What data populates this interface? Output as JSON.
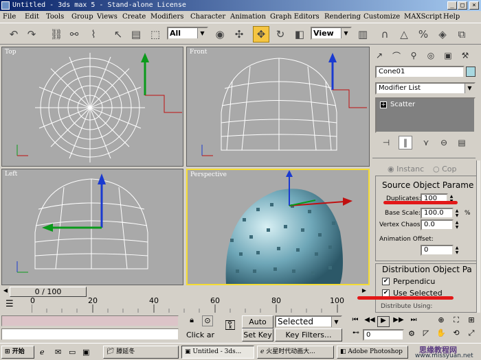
{
  "window": {
    "title": "Untitled - 3ds max 5 - Stand-alone License",
    "min": "_",
    "max": "□",
    "close": "×"
  },
  "menu": [
    "File",
    "Edit",
    "Tools",
    "Group",
    "Views",
    "Create",
    "Modifiers",
    "Character",
    "Animation",
    "Graph Editors",
    "Rendering",
    "Customize",
    "MAXScript",
    "Help"
  ],
  "toolbar": {
    "selection_filter": "All",
    "ref_coord": "View"
  },
  "viewports": {
    "top": "Top",
    "front": "Front",
    "left": "Left",
    "perspective": "Perspective"
  },
  "command_panel": {
    "object_name": "Cone01",
    "modifier_list": "Modifier List",
    "stack_item": "Scatter",
    "stack_toggle": "+",
    "instance": "Instanc",
    "copy": "Cop",
    "source_group": "Source Object Parame",
    "duplicates_label": "Duplicates:",
    "duplicates_value": "100",
    "base_scale_label": "Base Scale:",
    "base_scale_value": "100.0",
    "percent": "%",
    "vertex_chaos_label": "Vertex Chaos:",
    "vertex_chaos_value": "0.0",
    "anim_offset_label": "Animation Offset:",
    "anim_offset_value": "0",
    "dist_group": "Distribution Object Pa",
    "perpendicular": "Perpendicu",
    "use_selected": "Use Selected",
    "dist_using": "Distribute Using:",
    "check": "✔"
  },
  "timeline": {
    "frame_label": "0 / 100",
    "ticks": [
      "0",
      "20",
      "40",
      "60",
      "80",
      "100"
    ]
  },
  "status": {
    "click_hint": "Click ar",
    "auto_key": "Auto Key",
    "set_key": "Set Key",
    "key_mode": "Selected",
    "key_filters": "Key Filters...",
    "frame": "0"
  },
  "taskbar": {
    "start": "开始",
    "items": [
      "滕延冬",
      "Untitled - 3ds...",
      "火星时代动画大...",
      "Adobe Photoshop"
    ],
    "watermark_cn": "思缘教程网",
    "watermark_url": "www.missyuan.net"
  },
  "colors": {
    "accent": "#f5c542",
    "annotation": "#e21818",
    "viewport_bg": "#a9a9a9"
  }
}
